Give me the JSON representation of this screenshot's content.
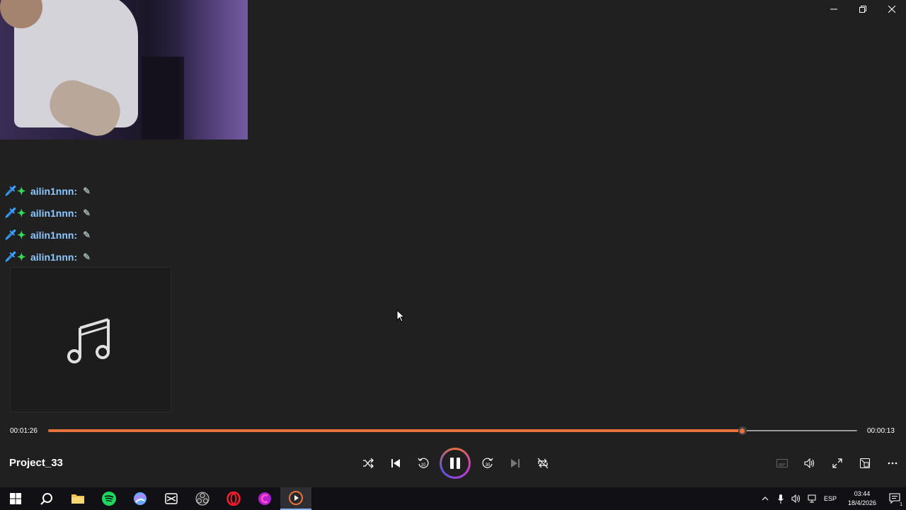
{
  "window": {
    "minimize_icon": "minimize-icon",
    "restore_icon": "restore-icon",
    "close_icon": "close-icon"
  },
  "chat": {
    "messages": [
      {
        "username": "ailin1nnn:",
        "emote": "feather-emote"
      },
      {
        "username": "ailin1nnn:",
        "emote": "feather-emote"
      },
      {
        "username": "ailin1nnn:",
        "emote": "feather-emote"
      },
      {
        "username": "ailin1nnn:",
        "emote": "feather-emote"
      }
    ]
  },
  "player": {
    "song_title": "Project_33",
    "elapsed": "00:01:26",
    "remaining": "00:00:13",
    "progress_fraction": 0.858,
    "accent_color": "#e8713c",
    "controls": [
      "shuffle",
      "previous",
      "rewind-10",
      "pause",
      "forward-30",
      "next",
      "repeat"
    ],
    "rewind_label": "10",
    "forward_label": "30"
  },
  "taskbar": {
    "apps": [
      "windows-start",
      "search",
      "file-explorer",
      "spotify",
      "app-icon",
      "capcut",
      "obs",
      "opera",
      "canva",
      "media-player"
    ],
    "tray": {
      "language": "ESP",
      "time": "03:44",
      "date": "18/4/2026",
      "notification_count": "1"
    }
  }
}
